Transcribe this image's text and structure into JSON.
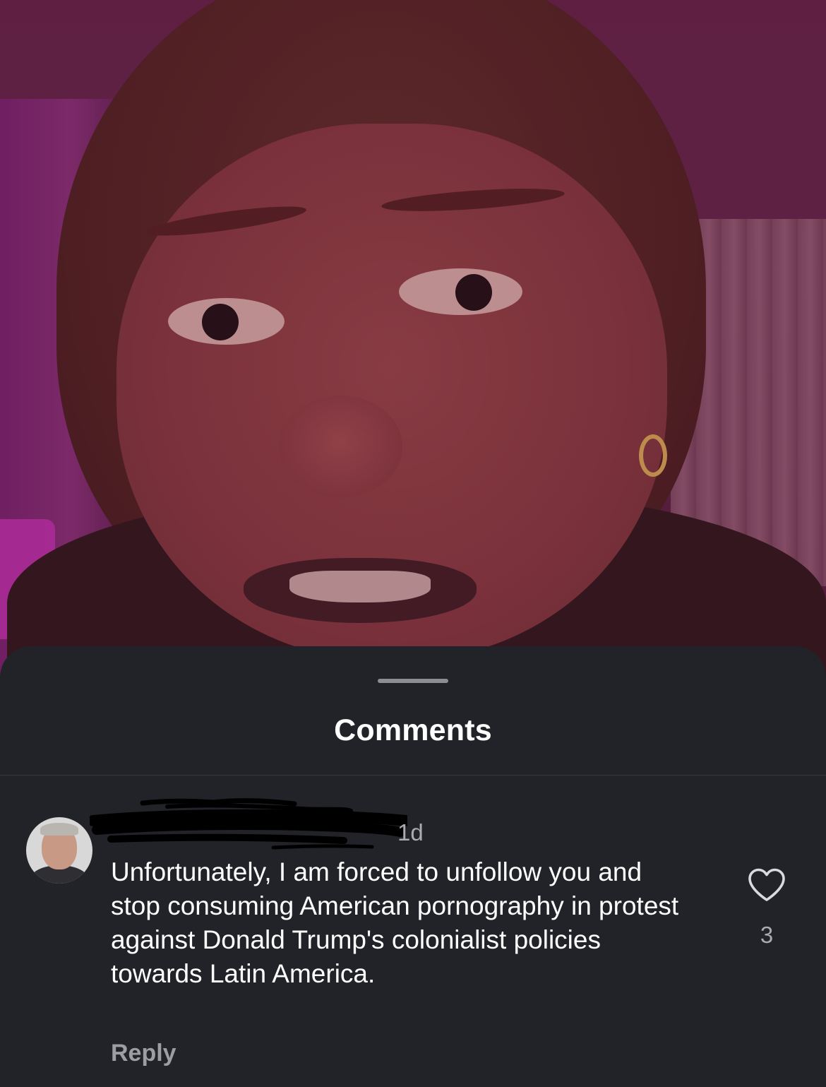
{
  "sheet": {
    "title": "Comments"
  },
  "comment": {
    "timestamp": "1d",
    "text": "Unfortunately, I am forced to unfollow you and stop consuming American pornography in protest against Donald Trump's colonialist policies towards Latin America.",
    "reply_label": "Reply",
    "like_count": "3"
  },
  "colors": {
    "sheet_background": "#212328",
    "primary_text": "#ffffff",
    "secondary_text": "#a9abb0"
  },
  "icons": {
    "like": "heart-outline-icon"
  }
}
